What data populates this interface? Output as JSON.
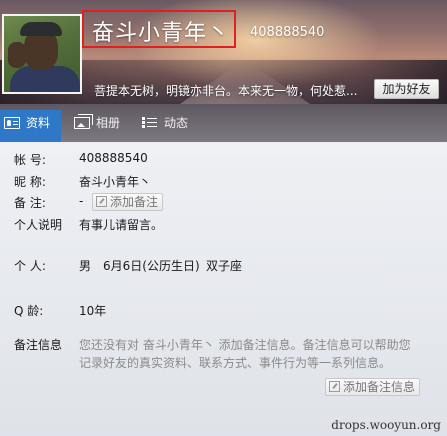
{
  "header": {
    "nickname": "奋斗小青年丶",
    "qq_number": "408888540",
    "signature": "菩提本无树，明镜亦非台。本来无一物，何处惹...",
    "add_friend_label": "加为好友"
  },
  "tabs": [
    {
      "label": "资料",
      "icon": "profile-card-icon",
      "active": true
    },
    {
      "label": "相册",
      "icon": "photo-album-icon",
      "active": false
    },
    {
      "label": "动态",
      "icon": "feed-list-icon",
      "active": false
    }
  ],
  "profile": {
    "account": {
      "label": "帐    号:",
      "value": "408888540"
    },
    "nickname": {
      "label": "昵    称:",
      "value": "奋斗小青年丶"
    },
    "remark": {
      "label": "备    注:",
      "value": "-",
      "button": "添加备注"
    },
    "bio": {
      "label": "个人说明",
      "value": "有事儿请留言。"
    },
    "personal": {
      "label": "个    人:",
      "gender": "男",
      "birthday": "6月6日(公历生日)",
      "zodiac": "双子座"
    },
    "age": {
      "label": "Q    龄:",
      "value": "10年"
    },
    "remark_info": {
      "label": "备注信息",
      "description": "您还没有对 奋斗小青年丶 添加备注信息。备注信息可以帮助您记录好友的真实资料、联系方式、事件行为等一系列信息。",
      "button": "添加备注信息"
    }
  },
  "watermark": "drops.wooyun.org"
}
